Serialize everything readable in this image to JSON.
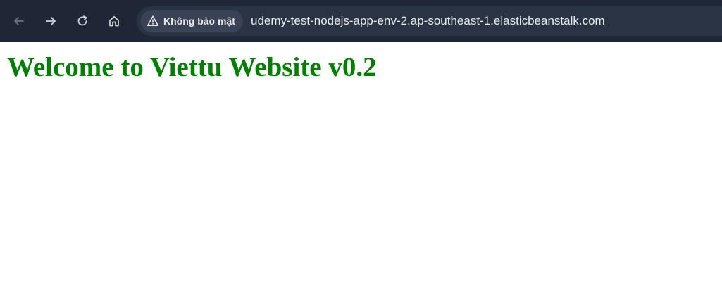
{
  "browser": {
    "security_chip": {
      "label": "Không bảo mật",
      "icon": "warning-triangle-icon"
    },
    "address_bar": {
      "url": "udemy-test-nodejs-app-env-2.ap-southeast-1.elasticbeanstalk.com"
    },
    "nav": {
      "back_icon": "arrow-left-icon",
      "forward_icon": "arrow-right-icon",
      "reload_icon": "reload-icon",
      "home_icon": "home-icon"
    },
    "colors": {
      "toolbar_bg": "#1f2736",
      "omnibox_bg": "#2b3445",
      "chip_bg": "#3a4355",
      "text": "#e8eaed"
    }
  },
  "page": {
    "heading": "Welcome to Viettu Website v0.2",
    "heading_color": "#008000"
  }
}
